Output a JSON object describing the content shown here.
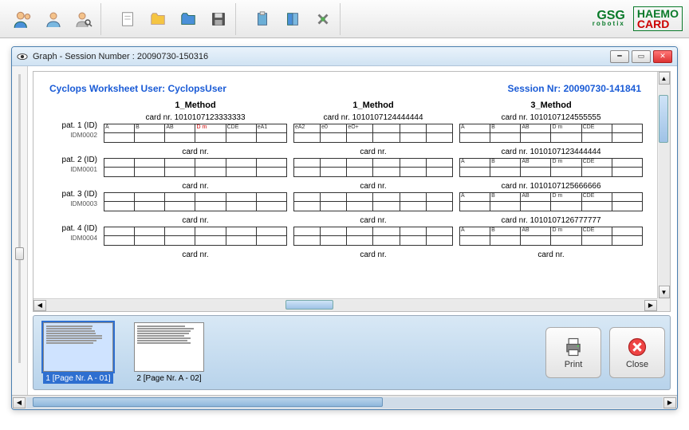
{
  "toolbar": {
    "icons": [
      "user-group-icon",
      "single-user-icon",
      "user-lookup-icon",
      "new-doc-icon",
      "open-folder-icon",
      "open-folder-2-icon",
      "save-icon",
      "clipboard-icon",
      "book-icon",
      "tools-icon"
    ]
  },
  "logos": {
    "gsg": "GSG",
    "gsg_sub": "robotix",
    "haemo1": "HAEMO",
    "haemo2": "CARD"
  },
  "window": {
    "title": "Graph  -  Session Number : 20090730-150316"
  },
  "worksheet": {
    "user_label": "Cyclops Worksheet User: CyclopsUser",
    "session_label": "Session Nr: 20090730-141841",
    "methods": [
      "1_Method",
      "1_Method",
      "3_Method"
    ],
    "rows": [
      {
        "patient": "pat. 1 (ID)",
        "patient_id": "IDM0002",
        "cards": [
          {
            "nr": "card nr. 1010107123333333",
            "cells": [
              "A",
              "B",
              "AB",
              "D m",
              "CDE",
              "eA1"
            ],
            "red_idx": 3
          },
          {
            "nr": "card nr. 1010107124444444",
            "cells": [
              "eA2",
              "e0",
              "eO+",
              "",
              "",
              ""
            ]
          },
          {
            "nr": "card nr. 1010107124555555",
            "cells": [
              "A",
              "B",
              "AB",
              "D m",
              "CDE",
              ""
            ]
          }
        ]
      },
      {
        "patient": "pat. 2 (ID)",
        "patient_id": "IDM0001",
        "cards": [
          {
            "nr": "card nr.",
            "cells": [
              "",
              "",
              "",
              "",
              "",
              ""
            ]
          },
          {
            "nr": "card nr.",
            "cells": [
              "",
              "",
              "",
              "",
              "",
              ""
            ]
          },
          {
            "nr": "card nr. 1010107123444444",
            "cells": [
              "A",
              "B",
              "AB",
              "D m",
              "CDE",
              ""
            ]
          }
        ]
      },
      {
        "patient": "pat. 3 (ID)",
        "patient_id": "IDM0003",
        "cards": [
          {
            "nr": "card nr.",
            "cells": [
              "",
              "",
              "",
              "",
              "",
              ""
            ]
          },
          {
            "nr": "card nr.",
            "cells": [
              "",
              "",
              "",
              "",
              "",
              ""
            ]
          },
          {
            "nr": "card nr. 1010107125666666",
            "cells": [
              "A",
              "B",
              "AB",
              "D m",
              "CDE",
              ""
            ]
          }
        ]
      },
      {
        "patient": "pat. 4 (ID)",
        "patient_id": "IDM0004",
        "cards": [
          {
            "nr": "card nr.",
            "cells": [
              "",
              "",
              "",
              "",
              "",
              ""
            ]
          },
          {
            "nr": "card nr.",
            "cells": [
              "",
              "",
              "",
              "",
              "",
              ""
            ]
          },
          {
            "nr": "card nr. 1010107126777777",
            "cells": [
              "A",
              "B",
              "AB",
              "D m",
              "CDE",
              ""
            ]
          }
        ]
      },
      {
        "patient": "",
        "patient_id": "",
        "cards": [
          {
            "nr": "card nr.",
            "cells": null
          },
          {
            "nr": "card nr.",
            "cells": null
          },
          {
            "nr": "card nr.",
            "cells": null
          }
        ]
      }
    ]
  },
  "pages": [
    {
      "caption": "1 [Page Nr. A - 01]",
      "selected": true
    },
    {
      "caption": "2 [Page Nr. A - 02]",
      "selected": false
    }
  ],
  "buttons": {
    "print": "Print",
    "close": "Close"
  }
}
